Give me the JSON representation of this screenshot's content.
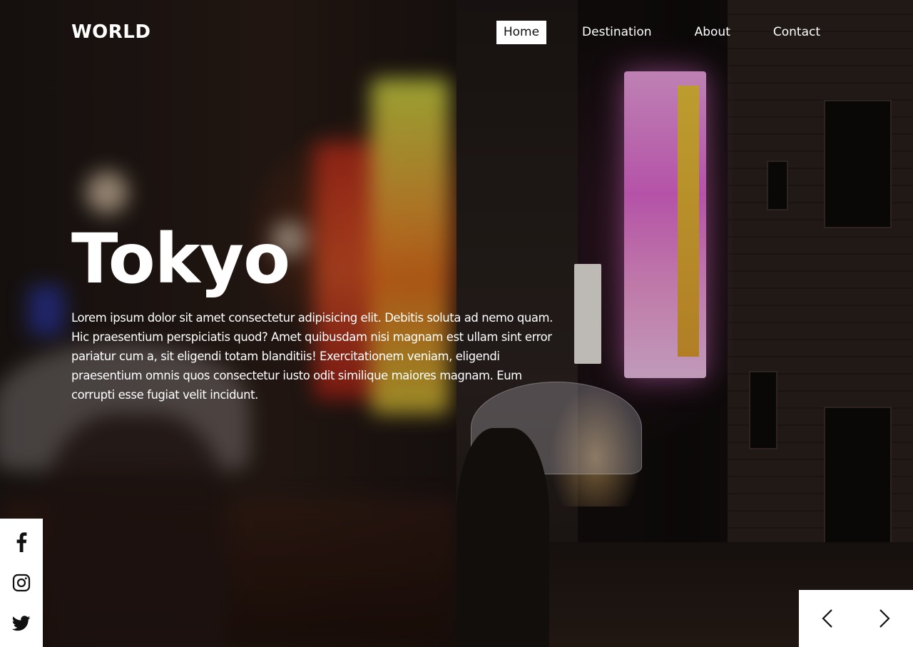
{
  "brand": {
    "logo": "WORLD"
  },
  "nav": {
    "items": [
      {
        "label": "Home",
        "active": true
      },
      {
        "label": "Destination",
        "active": false
      },
      {
        "label": "About",
        "active": false
      },
      {
        "label": "Contact",
        "active": false
      }
    ]
  },
  "hero": {
    "title": "Tokyo",
    "description": "Lorem ipsum dolor sit amet consectetur adipisicing elit. Debitis soluta ad nemo quam. Hic praesentium perspiciatis quod? Amet quibusdam nisi magnam est ullam sint error pariatur cum a, sit eligendi totam blanditiis! Exercitationem veniam, eligendi praesentium omnis quos consectetur iusto odit similique maiores magnam. Eum corrupti esse fugiat velit incidunt."
  },
  "social": {
    "icons": [
      "facebook-icon",
      "instagram-icon",
      "twitter-icon"
    ]
  },
  "slider": {
    "icons": [
      "chevron-left-icon",
      "chevron-right-icon"
    ]
  },
  "colors": {
    "text": "#ffffff",
    "panel_bg": "#ffffff",
    "active_nav_text": "#111111",
    "icon": "#111111"
  }
}
